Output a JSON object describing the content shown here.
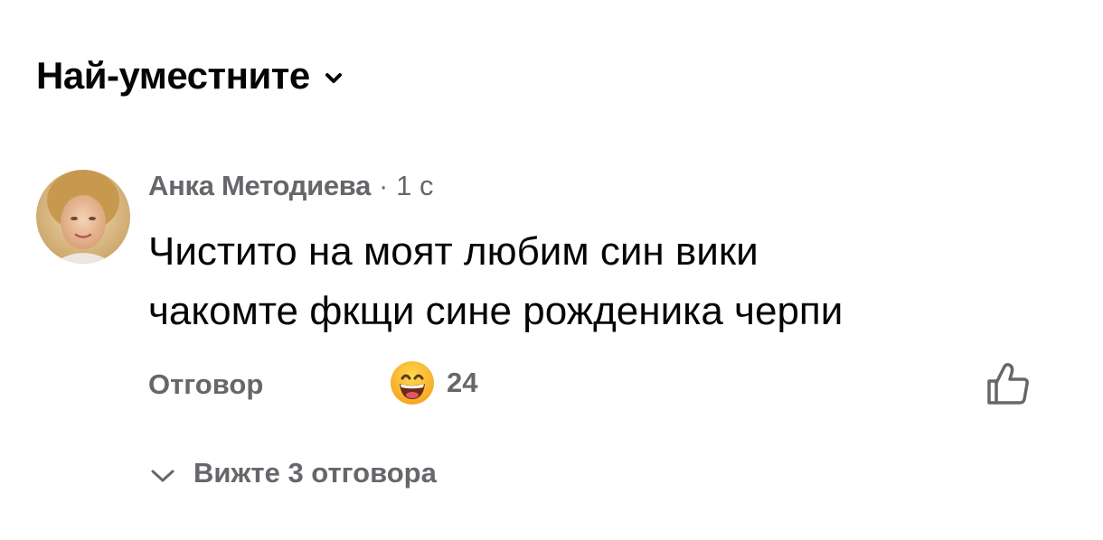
{
  "sort": {
    "label": "Най-уместните",
    "icon": "chevron-down-icon"
  },
  "comment": {
    "author": "Анка Методиева",
    "separator": "·",
    "time": "1 с",
    "text_lines": [
      "Чистито на моят любим син вики",
      "чакомте фкщи сине рожденика черпи"
    ],
    "avatar_icon": "user-avatar",
    "actions": {
      "reply_label": "Отговор",
      "reaction_icon": "grinning-face-icon",
      "reaction_count": "24",
      "like_icon": "thumbs-up-icon"
    }
  },
  "replies": {
    "icon": "chevron-down-icon",
    "label": "Вижте 3 отговора"
  },
  "colors": {
    "text_primary": "#050505",
    "text_secondary": "#65676b",
    "background": "#ffffff",
    "emoji_yellow": "#f7b125"
  }
}
